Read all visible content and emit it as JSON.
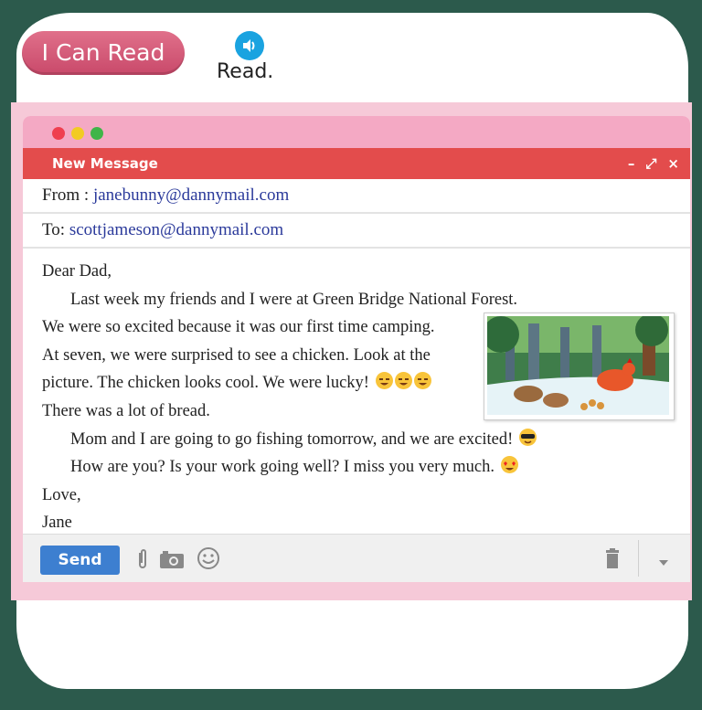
{
  "header": {
    "badge_label": "I Can Read",
    "instruction": "Read.",
    "speaker_icon": "speaker-icon"
  },
  "window": {
    "title": "New Message",
    "controls": [
      "–",
      "⤢",
      "×"
    ],
    "traffic_lights": [
      "#ef3f4f",
      "#f2cb23",
      "#3fb548"
    ]
  },
  "email": {
    "from_label": "From :",
    "from_address": "janebunny@dannymail.com",
    "to_label": "To:",
    "to_address": "scottjameson@dannymail.com",
    "greeting": "Dear Dad,",
    "line1": "Last week my friends and I were at Green Bridge National Forest.",
    "line2": "We were so excited because it was our first time camping.",
    "line3": "At seven, we were surprised to see a chicken. Look at the",
    "line4": "picture. The chicken looks cool. We were lucky!",
    "line5": "There was a lot of bread.",
    "line6": "Mom and I are going to go fishing tomorrow, and we are excited!",
    "line7": "How are you? Is your work going well? I miss you very much.",
    "closing": "Love,",
    "signature": "Jane"
  },
  "toolbar": {
    "send_label": "Send",
    "icons": [
      "paperclip-icon",
      "camera-icon",
      "smiley-icon",
      "trash-icon",
      "dropdown-arrow-icon"
    ]
  },
  "colors": {
    "background": "#2c5a4c",
    "frame_pink": "#f6c9d8",
    "header_red": "#e34c4c",
    "send_blue": "#3d7fd0",
    "link_blue": "#2b3a9b"
  }
}
